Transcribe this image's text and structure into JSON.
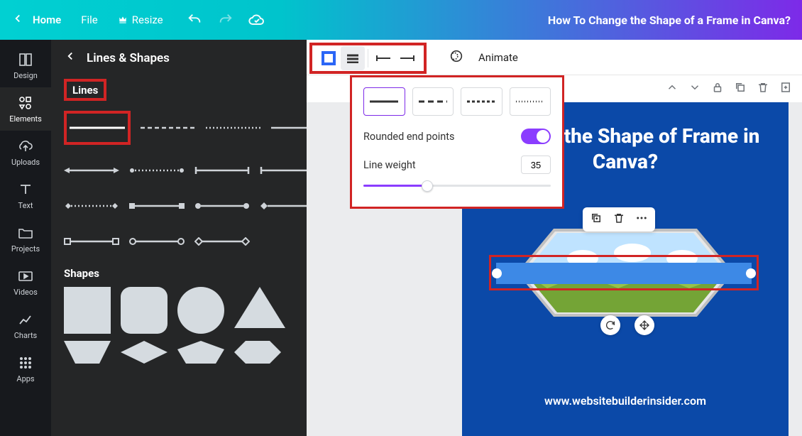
{
  "topbar": {
    "home": "Home",
    "file": "File",
    "resize": "Resize",
    "title": "How To Change the Shape of a Frame in Canva?"
  },
  "rail": {
    "items": [
      "Design",
      "Elements",
      "Uploads",
      "Text",
      "Projects",
      "Videos",
      "Charts",
      "Apps"
    ]
  },
  "panel": {
    "title": "Lines & Shapes",
    "lines_label": "Lines",
    "shapes_label": "Shapes"
  },
  "toolbar2": {
    "animate": "Animate"
  },
  "popover": {
    "rounded_label": "Rounded end points",
    "weight_label": "Line weight",
    "weight_value": "35"
  },
  "canvas": {
    "heading": "Change the Shape of Frame in Canva?",
    "url": "www.websitebuilderinsider.com"
  }
}
